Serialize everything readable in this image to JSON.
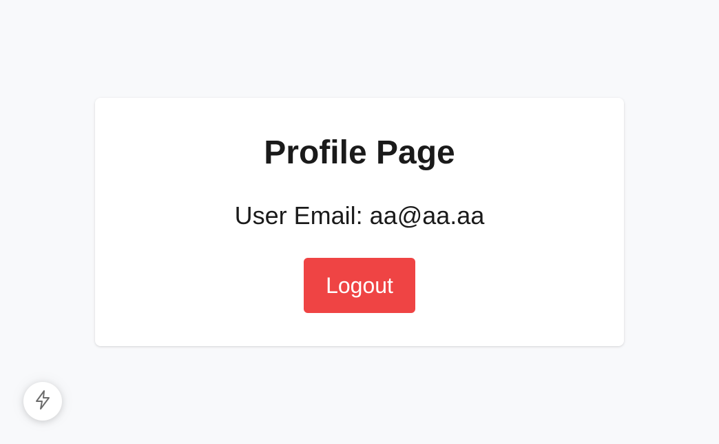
{
  "page": {
    "title": "Profile Page",
    "email_label": "User Email:",
    "email_value": "aa@aa.aa",
    "logout_label": "Logout"
  },
  "dev_indicator": {
    "icon": "lightning-bolt-icon"
  },
  "colors": {
    "background": "#f8f9fb",
    "card": "#ffffff",
    "text": "#1a1a1a",
    "logout_button": "#ef4444",
    "logout_text": "#ffffff"
  }
}
